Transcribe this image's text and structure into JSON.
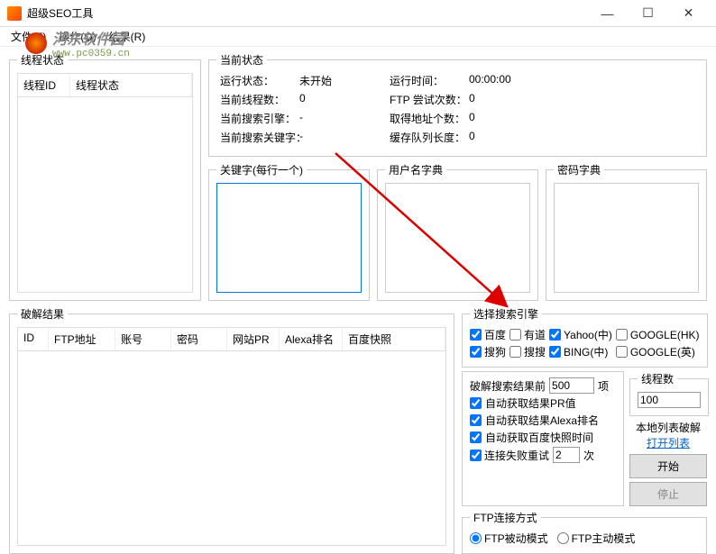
{
  "window": {
    "title": "超级SEO工具",
    "minimize": "—",
    "maximize": "☐",
    "close": "✕"
  },
  "menu": {
    "file": "文件(F)",
    "operation": "操作(O)",
    "result": "结果(R)"
  },
  "watermark": {
    "site_cn": "河东软件园",
    "site_url": "www.pc0359.cn"
  },
  "thread_status": {
    "legend": "线程状态",
    "col_id": "线程ID",
    "col_status": "线程状态"
  },
  "current_status": {
    "legend": "当前状态",
    "run_status_label": "运行状态：",
    "run_status_value": "未开始",
    "run_time_label": "运行时间：",
    "run_time_value": "00:00:00",
    "thread_count_label": "当前线程数：",
    "thread_count_value": "0",
    "ftp_retry_label": "FTP 尝试次数：",
    "ftp_retry_value": "0",
    "engine_label": "当前搜索引擎：",
    "engine_value": "-",
    "addr_count_label": "取得地址个数：",
    "addr_count_value": "0",
    "keyword_label": "当前搜索关键字：",
    "keyword_value": "-",
    "queue_label": "缓存队列长度：",
    "queue_value": "0"
  },
  "dicts": {
    "keywords_legend": "关键字(每行一个)",
    "username_legend": "用户名字典",
    "password_legend": "密码字典"
  },
  "crack_result": {
    "legend": "破解结果",
    "col_id": "ID",
    "col_ftp": "FTP地址",
    "col_account": "账号",
    "col_password": "密码",
    "col_pr": "网站PR",
    "col_alexa": "Alexa排名",
    "col_snapshot": "百度快照"
  },
  "engines": {
    "legend": "选择搜索引擎",
    "baidu": "百度",
    "youdao": "有道",
    "yahoo": "Yahoo(中)",
    "google_hk": "GOOGLE(HK)",
    "sogou": "搜狗",
    "soso": "搜搜",
    "bing": "BING(中)",
    "google_en": "GOOGLE(英)"
  },
  "crack_opts": {
    "prefix": "破解搜索结果前",
    "count_value": "500",
    "suffix": "项",
    "auto_pr": "自动获取结果PR值",
    "auto_alexa": "自动获取结果Alexa排名",
    "auto_snapshot": "自动获取百度快照时间",
    "retry_label": "连接失败重试",
    "retry_value": "2",
    "retry_suffix": "次"
  },
  "threads": {
    "legend": "线程数",
    "value": "100"
  },
  "local_list": {
    "label": "本地列表破解",
    "link": "打开列表"
  },
  "buttons": {
    "start": "开始",
    "stop": "停止"
  },
  "ftp_mode": {
    "legend": "FTP连接方式",
    "passive": "FTP被动模式",
    "active": "FTP主动模式"
  }
}
